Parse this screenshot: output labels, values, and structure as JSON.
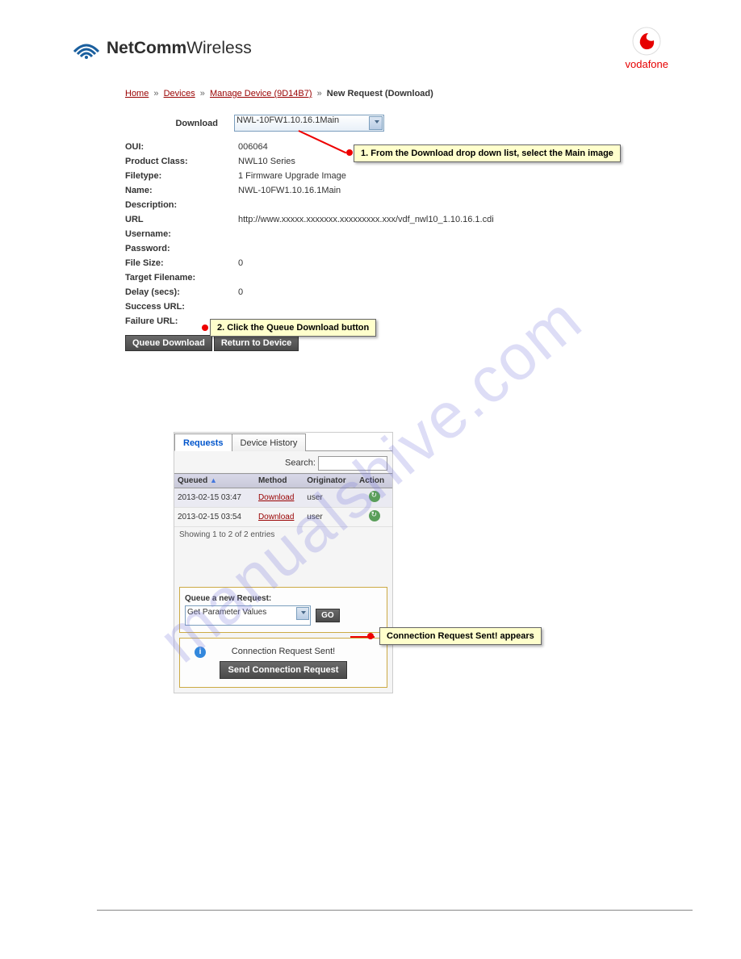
{
  "logo": {
    "brand_bold": "NetComm",
    "brand_light": "Wireless",
    "vodafone": "vodafone"
  },
  "breadcrumb": {
    "home": "Home",
    "devices": "Devices",
    "manage": "Manage Device (9D14B7)",
    "current": "New Request (Download)",
    "sep": "»"
  },
  "form": {
    "download_label": "Download",
    "download_value": "NWL-10FW1.10.16.1Main",
    "oui_label": "OUI:",
    "oui_value": "006064",
    "pclass_label": "Product Class:",
    "pclass_value": "NWL10 Series",
    "ftype_label": "Filetype:",
    "ftype_value": "1 Firmware Upgrade Image",
    "name_label": "Name:",
    "name_value": "NWL-10FW1.10.16.1Main",
    "desc_label": "Description:",
    "url_label": "URL",
    "url_value": "http://www.xxxxx.xxxxxxx.xxxxxxxxx.xxx/vdf_nwl10_1.10.16.1.cdi",
    "user_label": "Username:",
    "pass_label": "Password:",
    "fsize_label": "File Size:",
    "fsize_value": "0",
    "tfile_label": "Target Filename:",
    "delay_label": "Delay (secs):",
    "delay_value": "0",
    "surl_label": "Success URL:",
    "furl_label": "Failure URL:",
    "btn_queue": "Queue Download",
    "btn_return": "Return to Device"
  },
  "callout1": "1. From the Download drop down list, select the Main image",
  "callout2": "2. Click the Queue Download button",
  "callout3": "Connection Request Sent! appears",
  "panel": {
    "tab_requests": "Requests",
    "tab_history": "Device History",
    "search_label": "Search:",
    "th_queued": "Queued",
    "th_method": "Method",
    "th_orig": "Originator",
    "th_action": "Action",
    "rows": [
      {
        "queued": "2013-02-15 03:47",
        "method": "Download",
        "orig": "user"
      },
      {
        "queued": "2013-02-15 03:54",
        "method": "Download",
        "orig": "user"
      }
    ],
    "showing": "Showing 1 to 2 of 2 entries",
    "queue_label": "Queue a new Request:",
    "queue_value": "Get Parameter Values",
    "go": "GO",
    "conn_text": "Connection Request Sent!",
    "send_btn": "Send Connection Request"
  },
  "watermark": "manualshive.com"
}
